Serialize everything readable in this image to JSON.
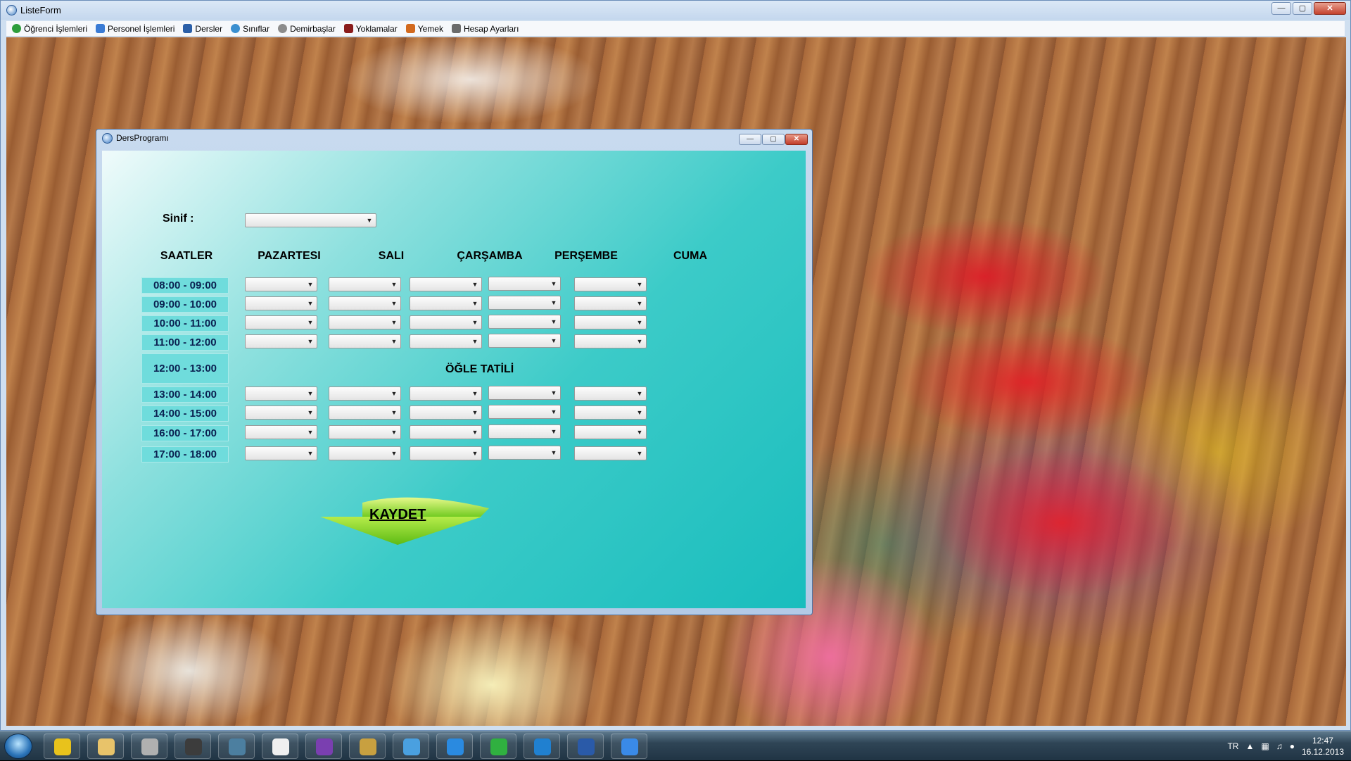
{
  "window": {
    "title": "ListeForm"
  },
  "menu": [
    {
      "label": "Öğrenci İşlemleri",
      "icon": "check-icon",
      "color": "#2e9e3c"
    },
    {
      "label": "Personel İşlemleri",
      "icon": "arrows-icon",
      "color": "#3a7bd5"
    },
    {
      "label": "Dersler",
      "icon": "snowflake-icon",
      "color": "#2b5fa8"
    },
    {
      "label": "Sınıflar",
      "icon": "person-icon",
      "color": "#3a8fd0"
    },
    {
      "label": "Demirbaşlar",
      "icon": "gear-icon",
      "color": "#8c8c8c"
    },
    {
      "label": "Yoklamalar",
      "icon": "shield-icon",
      "color": "#8a1c1c"
    },
    {
      "label": "Yemek",
      "icon": "food-icon",
      "color": "#d2691e"
    },
    {
      "label": "Hesap Ayarları",
      "icon": "notes-icon",
      "color": "#6b6b6b"
    }
  ],
  "dialog": {
    "title": "DersProgramı",
    "sinif_label": "Sinif :",
    "sinif_value": "",
    "headers": {
      "saatler": "SAATLER",
      "days": [
        "PAZARTESI",
        "SALI",
        "ÇARŞAMBA",
        "PERŞEMBE",
        "CUMA"
      ]
    },
    "times": [
      "08:00 - 09:00",
      "09:00 - 10:00",
      "10:00 - 11:00",
      "11:00 - 12:00",
      "12:00 - 13:00",
      "13:00 - 14:00",
      "14:00 - 15:00",
      "16:00 - 17:00",
      "17:00 - 18:00"
    ],
    "lunch_label": "ÖĞLE TATİLİ",
    "save_label": "KAYDET"
  },
  "taskbar": {
    "language": "TR",
    "time": "12:47",
    "date": "16.12.2013",
    "apps": [
      {
        "name": "chrome-icon",
        "color": "#e8c21c"
      },
      {
        "name": "explorer-icon",
        "color": "#e8c36a"
      },
      {
        "name": "books-icon",
        "color": "#b0b0b0"
      },
      {
        "name": "media-icon",
        "color": "#3c3c3c"
      },
      {
        "name": "network-icon",
        "color": "#4c7fa0"
      },
      {
        "name": "yandex-icon",
        "color": "#f0f0f0"
      },
      {
        "name": "visual-studio-icon",
        "color": "#7a3fb0"
      },
      {
        "name": "tools-icon",
        "color": "#c8a040"
      },
      {
        "name": "messenger-icon",
        "color": "#4aa0e0"
      },
      {
        "name": "app-store-icon",
        "color": "#2a8ae0"
      },
      {
        "name": "transfer-icon",
        "color": "#30b040"
      },
      {
        "name": "browser-icon",
        "color": "#2080d0"
      },
      {
        "name": "word-icon",
        "color": "#2a5aa8"
      },
      {
        "name": "download-icon",
        "color": "#3a8ae8"
      }
    ]
  }
}
